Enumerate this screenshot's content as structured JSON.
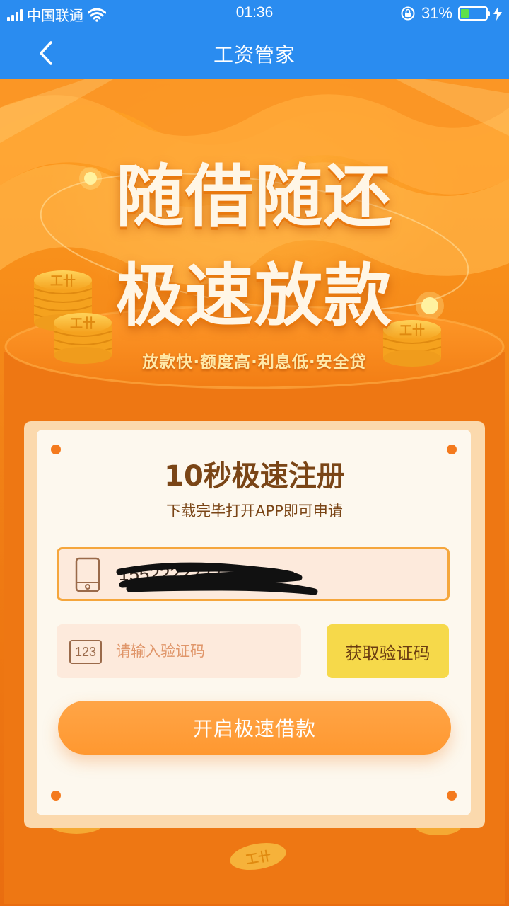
{
  "status_bar": {
    "carrier": "中国联通",
    "time": "01:36",
    "battery_percent": "31%",
    "battery_level": 0.31,
    "icons": [
      "signal-icon",
      "wifi-icon",
      "rotation-lock-icon",
      "battery-icon",
      "charging-icon"
    ]
  },
  "nav": {
    "title": "工资管家",
    "back_icon": "chevron-left-icon"
  },
  "hero": {
    "slogan_line1": "随借随还",
    "slogan_line2": "极速放款",
    "tagline": "放款快·额度高·利息低·安全贷"
  },
  "form": {
    "title": "10秒极速注册",
    "subtitle": "下载完毕打开APP即可申请",
    "phone_value": "1552222222",
    "code_placeholder": "请输入验证码",
    "code_icon_text": "123",
    "get_code_label": "获取验证码",
    "submit_label": "开启极速借款"
  },
  "colors": {
    "nav_blue": "#2a8cf0",
    "hero_orange": "#f07b14",
    "card_bg": "#fdf8ee",
    "get_code_yellow": "#f6d94a",
    "submit_orange": "#ff9d3a",
    "title_brown": "#7a4516"
  }
}
